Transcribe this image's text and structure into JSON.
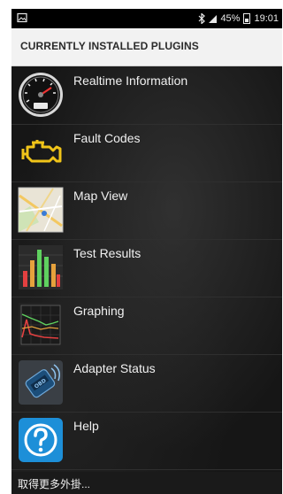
{
  "status_bar": {
    "battery": "45%",
    "time": "19:01",
    "left_icon": "gallery-icon",
    "right_icons": [
      "bluetooth-icon",
      "signal-icon",
      "battery-icon"
    ]
  },
  "header": {
    "title": "CURRENTLY INSTALLED PLUGINS"
  },
  "plugins": [
    {
      "label": "Realtime Information",
      "icon": "speedometer-icon"
    },
    {
      "label": "Fault Codes",
      "icon": "engine-warning-icon"
    },
    {
      "label": "Map View",
      "icon": "map-icon"
    },
    {
      "label": "Test Results",
      "icon": "bar-chart-icon"
    },
    {
      "label": "Graphing",
      "icon": "line-graph-icon"
    },
    {
      "label": "Adapter Status",
      "icon": "obd-adapter-icon"
    },
    {
      "label": "Help",
      "icon": "help-icon"
    }
  ],
  "footer": {
    "more_plugins_link": "取得更多外掛..."
  }
}
